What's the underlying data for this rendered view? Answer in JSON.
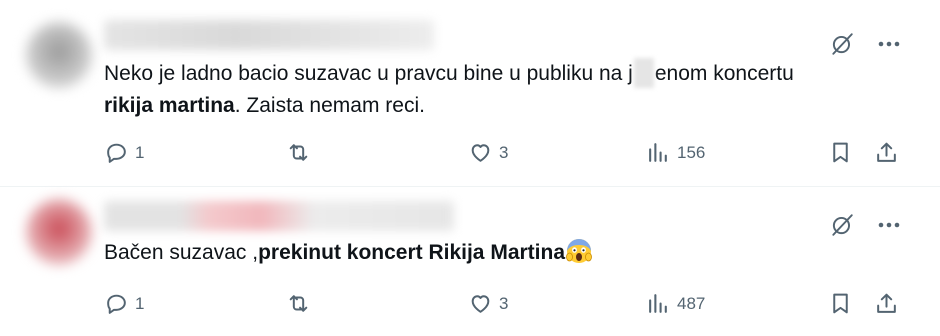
{
  "tweets": [
    {
      "text_a": "Neko je ladno bacio suzavac u pravcu bine u publiku na j",
      "text_b": "enom koncertu",
      "text_bold": "rikija martina",
      "text_c": ". Zaista nemam reci.",
      "replies": "1",
      "likes": "3",
      "views": "156"
    },
    {
      "text_a": "Bačen suzavac ,",
      "text_bold": "prekinut koncert Rikija Martina",
      "emoji": "face-screaming-in-fear",
      "replies": "1",
      "likes": "3",
      "views": "487"
    }
  ],
  "icons": {
    "grok": "grok-icon",
    "more": "more-icon",
    "reply": "reply-icon",
    "retweet": "retweet-icon",
    "like": "heart-icon",
    "views": "views-icon",
    "bookmark": "bookmark-icon",
    "share": "share-icon"
  },
  "colors": {
    "icon": "#536471",
    "text": "#0f1419",
    "divider": "#eff3f4"
  }
}
